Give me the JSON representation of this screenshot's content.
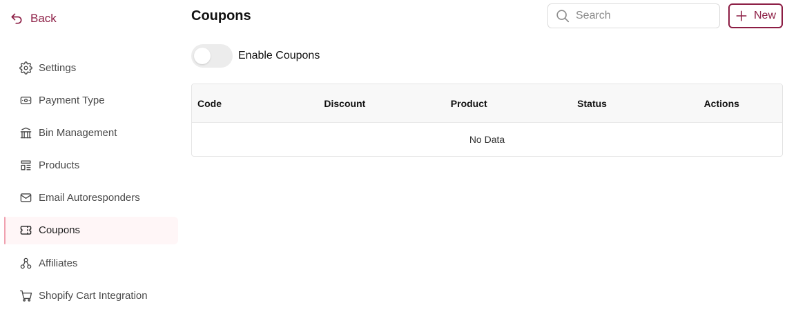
{
  "sidebar": {
    "back_label": "Back",
    "items": [
      {
        "label": "Settings",
        "icon": "gear-icon",
        "active": false
      },
      {
        "label": "Payment Type",
        "icon": "cash-icon",
        "active": false
      },
      {
        "label": "Bin Management",
        "icon": "bank-icon",
        "active": false
      },
      {
        "label": "Products",
        "icon": "layout-list-icon",
        "active": false
      },
      {
        "label": "Email Autoresponders",
        "icon": "mail-icon",
        "active": false
      },
      {
        "label": "Coupons",
        "icon": "ticket-icon",
        "active": true
      },
      {
        "label": "Affiliates",
        "icon": "sitemap-icon",
        "active": false
      },
      {
        "label": "Shopify Cart Integration",
        "icon": "cart-icon",
        "active": false
      }
    ]
  },
  "header": {
    "title": "Coupons",
    "search_placeholder": "Search",
    "search_value": "",
    "new_label": "New"
  },
  "toggle": {
    "label": "Enable Coupons",
    "enabled": false
  },
  "table": {
    "columns": [
      "Code",
      "Discount",
      "Product",
      "Status",
      "Actions"
    ],
    "empty_text": "No Data"
  },
  "colors": {
    "accent": "#8c1d44",
    "active_bg": "#fff6f7",
    "active_border": "#f0a1b0",
    "header_bg": "#f8f8f8"
  }
}
